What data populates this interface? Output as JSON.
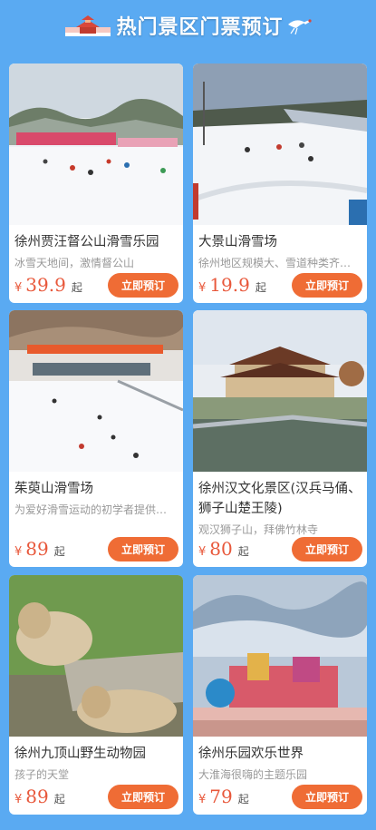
{
  "header": {
    "title": "热门景区门票预订"
  },
  "colors": {
    "background": "#5aaaf2",
    "price": "#e8583b",
    "button": "#ef6c35"
  },
  "cards": [
    {
      "name": "徐州贾汪督公山滑雪乐园",
      "desc": "冰雪天地间，激情督公山",
      "currency": "¥",
      "price": "39.9",
      "unit": "起",
      "button": "立即预订"
    },
    {
      "name": "大景山滑雪场",
      "desc": "徐州地区规模大、雪道种类齐全的滑雪场",
      "currency": "¥",
      "price": "19.9",
      "unit": "起",
      "button": "立即预订"
    },
    {
      "name": "茱萸山滑雪场",
      "desc": "为爱好滑雪运动的初学者提供了良好的场地",
      "currency": "¥",
      "price": "89",
      "unit": "起",
      "button": "立即预订"
    },
    {
      "name": "徐州汉文化景区(汉兵马俑、狮子山楚王陵)",
      "desc": "观汉狮子山，拜佛竹林寺",
      "currency": "¥",
      "price": "80",
      "unit": "起",
      "button": "立即预订"
    },
    {
      "name": "徐州九顶山野生动物园",
      "desc": "孩子的天堂",
      "currency": "¥",
      "price": "89",
      "unit": "起",
      "button": "立即预订"
    },
    {
      "name": "徐州乐园欢乐世界",
      "desc": "大淮海很嗨的主题乐园",
      "currency": "¥",
      "price": "79",
      "unit": "起",
      "button": "立即预订"
    }
  ]
}
